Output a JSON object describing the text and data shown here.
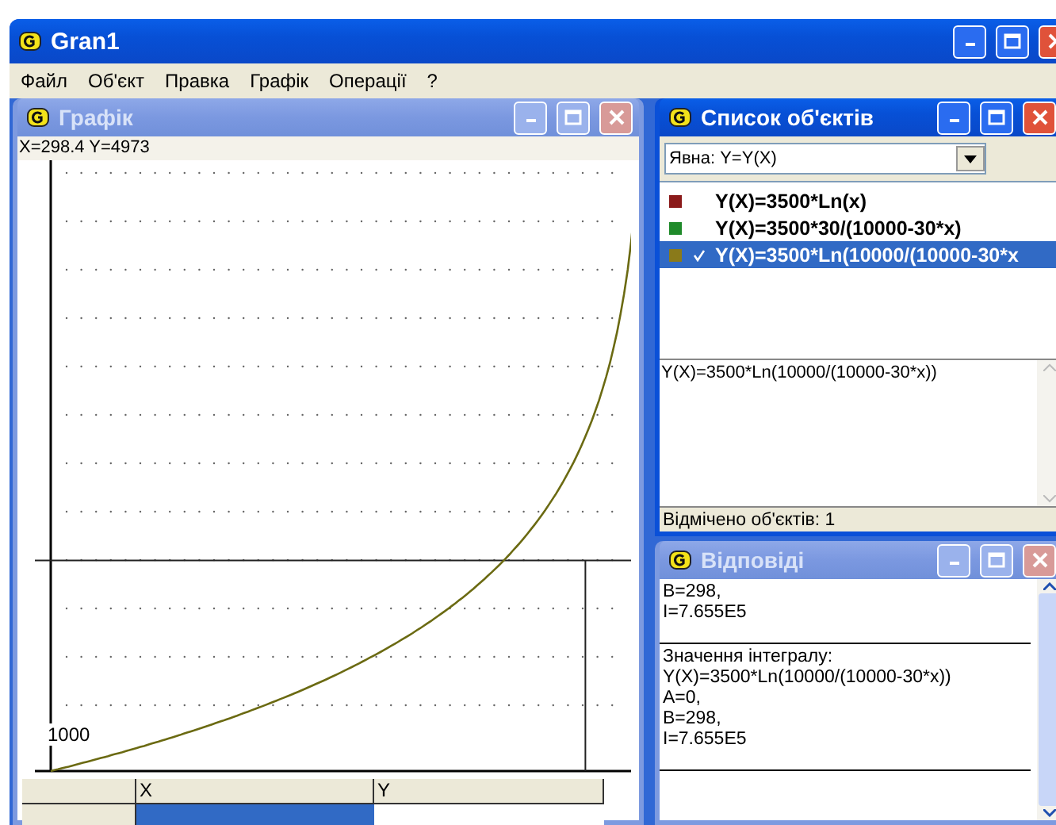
{
  "window": {
    "title": "Gran1",
    "active": true
  },
  "menu": [
    "Файл",
    "Об'єкт",
    "Правка",
    "Графік",
    "Операції",
    "?"
  ],
  "graph_window": {
    "title": "Графік",
    "active": false,
    "coords": "X=298.4 Y=4973",
    "axis_label": "1000",
    "table": {
      "columns": [
        {
          "label": "X",
          "selected": true
        },
        {
          "label": "Y",
          "selected": false
        }
      ]
    }
  },
  "objects_window": {
    "title": "Список об'єктів",
    "active": true,
    "filter": "Явна: Y=Y(X)",
    "items": [
      {
        "label": "Y(X)=3500*Ln(x)",
        "color": "#8b1a1a",
        "checked": false,
        "selected": false
      },
      {
        "label": "Y(X)=3500*30/(10000-30*x)",
        "color": "#1f8a2a",
        "checked": false,
        "selected": false
      },
      {
        "label": "Y(X)=3500*Ln(10000/(10000-30*x",
        "color": "#8a7a1a",
        "checked": true,
        "selected": true
      }
    ],
    "formula": "Y(X)=3500*Ln(10000/(10000-30*x))",
    "status": "Відмічено об'єктів: 1"
  },
  "answers_window": {
    "title": "Відповіді",
    "active": false,
    "blocks": [
      [
        "B=298,",
        "I=7.655E5"
      ],
      [
        "Значення інтегралу:",
        "Y(X)=3500*Ln(10000/(10000-30*x))",
        "A=0,",
        "B=298,",
        "I=7.655E5"
      ]
    ]
  }
}
